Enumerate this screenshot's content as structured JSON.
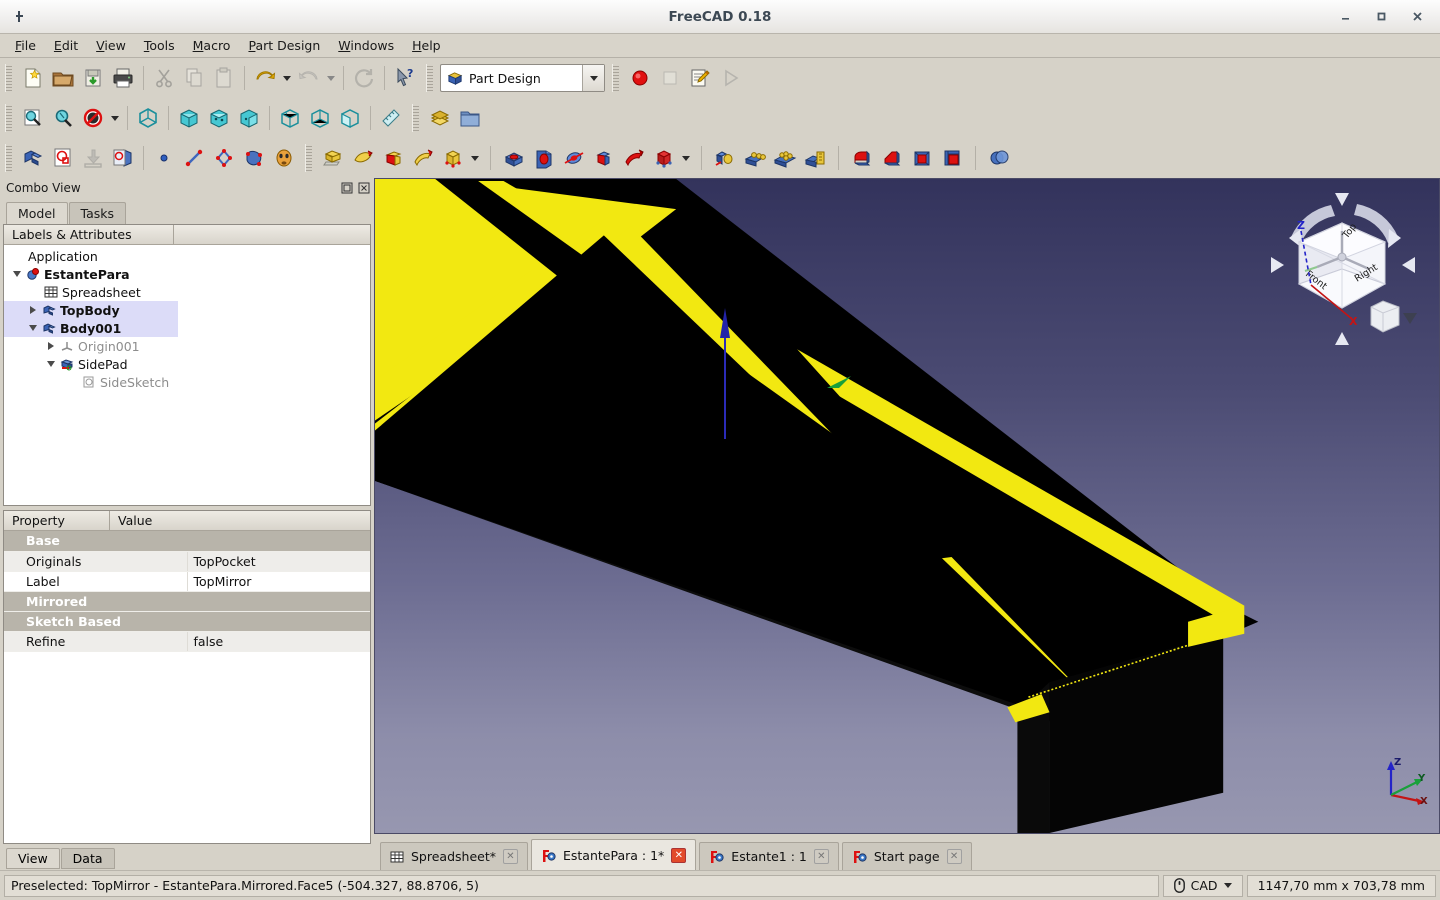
{
  "window": {
    "title": "FreeCAD 0.18",
    "app_icon": "freecad-icon",
    "minimize": "–",
    "maximize": "□",
    "close": "✕"
  },
  "menu": {
    "items": [
      {
        "label": "File",
        "mnemonic": "F"
      },
      {
        "label": "Edit",
        "mnemonic": "E"
      },
      {
        "label": "View",
        "mnemonic": "V"
      },
      {
        "label": "Tools",
        "mnemonic": "T"
      },
      {
        "label": "Macro",
        "mnemonic": "M"
      },
      {
        "label": "Part Design",
        "mnemonic": "P"
      },
      {
        "label": "Windows",
        "mnemonic": "W"
      },
      {
        "label": "Help",
        "mnemonic": "H"
      }
    ]
  },
  "toolbars": {
    "file": [
      {
        "icon": "new-document-icon",
        "label": "New"
      },
      {
        "icon": "open-folder-icon",
        "label": "Open"
      },
      {
        "icon": "save-icon",
        "label": "Save"
      },
      {
        "icon": "print-icon",
        "label": "Print"
      },
      {
        "icon": "cut-scissors-icon",
        "label": "Cut"
      },
      {
        "icon": "copy-icon",
        "label": "Copy"
      },
      {
        "icon": "paste-icon",
        "label": "Paste"
      },
      {
        "icon": "undo-arrow-icon",
        "label": "Undo"
      },
      {
        "icon": "redo-arrow-icon",
        "label": "Redo"
      },
      {
        "icon": "refresh-icon",
        "label": "Refresh"
      },
      {
        "icon": "whats-this-icon",
        "label": "What's This"
      }
    ],
    "workbench": {
      "icon": "part-design-icon",
      "value": "Part Design",
      "arrow": "chevron-down-icon"
    },
    "macro": [
      {
        "icon": "record-macro-icon",
        "label": "Macro recording"
      },
      {
        "icon": "stop-macro-icon",
        "label": "Stop macro recording"
      },
      {
        "icon": "edit-macro-icon",
        "label": "Macros"
      },
      {
        "icon": "execute-macro-icon",
        "label": "Execute macro"
      }
    ],
    "view": [
      {
        "icon": "fit-all-icon",
        "label": "Fit all"
      },
      {
        "icon": "fit-selection-icon",
        "label": "Fit selection"
      },
      {
        "icon": "draw-style-icon",
        "label": "Draw style"
      },
      {
        "icon": "axonometric-icon",
        "label": "Axonometric"
      },
      {
        "icon": "front-view-icon",
        "label": "Front"
      },
      {
        "icon": "top-view-icon",
        "label": "Top"
      },
      {
        "icon": "right-view-icon",
        "label": "Right"
      },
      {
        "icon": "rear-view-icon",
        "label": "Rear"
      },
      {
        "icon": "bottom-view-icon",
        "label": "Bottom"
      },
      {
        "icon": "left-view-icon",
        "label": "Left"
      },
      {
        "icon": "measure-icon",
        "label": "Measure"
      },
      {
        "icon": "layers-icon",
        "label": "Layers"
      },
      {
        "icon": "workbench-folder-icon",
        "label": "Folder"
      }
    ],
    "partdesign_helper": [
      {
        "icon": "create-body-icon",
        "label": "Create body"
      },
      {
        "icon": "create-sketch-icon",
        "label": "Create sketch"
      },
      {
        "icon": "attach-sketch-icon",
        "label": "Attach sketch"
      },
      {
        "icon": "edit-sketch-icon",
        "label": "Edit sketch"
      },
      {
        "icon": "datum-point-icon",
        "label": "Create datum point"
      },
      {
        "icon": "datum-line-icon",
        "label": "Create datum line"
      },
      {
        "icon": "datum-plane-icon",
        "label": "Create datum plane"
      },
      {
        "icon": "shape-binder-icon",
        "label": "Shape binder"
      },
      {
        "icon": "clone-icon",
        "label": "Sub-object shape binder"
      }
    ],
    "additive": [
      {
        "icon": "pad-icon",
        "label": "Pad"
      },
      {
        "icon": "revolution-icon",
        "label": "Revolution"
      },
      {
        "icon": "additive-loft-icon",
        "label": "Additive loft"
      },
      {
        "icon": "additive-pipe-icon",
        "label": "Additive pipe"
      },
      {
        "icon": "additive-box-icon",
        "label": "Additive box"
      }
    ],
    "subtractive": [
      {
        "icon": "pocket-icon",
        "label": "Pocket"
      },
      {
        "icon": "hole-icon",
        "label": "Hole"
      },
      {
        "icon": "groove-icon",
        "label": "Groove"
      },
      {
        "icon": "subtractive-loft-icon",
        "label": "Subtractive loft"
      },
      {
        "icon": "subtractive-pipe-icon",
        "label": "Subtractive pipe"
      },
      {
        "icon": "subtractive-box-icon",
        "label": "Subtractive box"
      }
    ],
    "transform": [
      {
        "icon": "mirrored-icon",
        "label": "Mirrored"
      },
      {
        "icon": "linear-pattern-icon",
        "label": "LinearPattern"
      },
      {
        "icon": "polar-pattern-icon",
        "label": "PolarPattern"
      },
      {
        "icon": "multi-transform-icon",
        "label": "Create MultiTransform"
      }
    ],
    "dressup": [
      {
        "icon": "fillet-icon",
        "label": "Fillet"
      },
      {
        "icon": "chamfer-icon",
        "label": "Chamfer"
      },
      {
        "icon": "draft-icon",
        "label": "Draft"
      },
      {
        "icon": "thickness-icon",
        "label": "Thickness"
      }
    ],
    "boolean": [
      {
        "icon": "boolean-icon",
        "label": "Boolean operation"
      }
    ]
  },
  "combo_view": {
    "title": "Combo View",
    "float_button": "undock-icon",
    "close_button": "close-icon",
    "tabs": [
      {
        "label": "Model",
        "active": true
      },
      {
        "label": "Tasks",
        "active": false
      }
    ],
    "tree_column_header": "Labels & Attributes",
    "tree": [
      {
        "label": "Application",
        "depth": 0,
        "twist": "none",
        "icon": "none",
        "bold": false,
        "dim": false,
        "selected": false
      },
      {
        "label": "EstantePara",
        "depth": 1,
        "twist": "open",
        "icon": "document-icon",
        "bold": true,
        "dim": false,
        "selected": false
      },
      {
        "label": "Spreadsheet",
        "depth": 2,
        "twist": "none",
        "icon": "spreadsheet-icon",
        "bold": false,
        "dim": false,
        "selected": false
      },
      {
        "label": "TopBody",
        "depth": 2,
        "twist": "closed",
        "icon": "body-icon",
        "bold": true,
        "dim": false,
        "selected": true
      },
      {
        "label": "Body001",
        "depth": 2,
        "twist": "open",
        "icon": "body-icon",
        "bold": true,
        "dim": false,
        "selected": true
      },
      {
        "label": "Origin001",
        "depth": 3,
        "twist": "closed",
        "icon": "origin-icon",
        "bold": false,
        "dim": true,
        "selected": false
      },
      {
        "label": "SidePad",
        "depth": 3,
        "twist": "open",
        "icon": "pad-feature-icon",
        "bold": false,
        "dim": false,
        "selected": false
      },
      {
        "label": "SideSketch",
        "depth": 4,
        "twist": "none",
        "icon": "sketch-icon",
        "bold": false,
        "dim": true,
        "selected": false
      }
    ],
    "property_headers": [
      "Property",
      "Value"
    ],
    "properties": [
      {
        "type": "group",
        "name": "Base",
        "value": ""
      },
      {
        "type": "row",
        "name": "Originals",
        "value": "TopPocket"
      },
      {
        "type": "row",
        "name": "Label",
        "value": "TopMirror"
      },
      {
        "type": "group",
        "name": "Mirrored",
        "value": ""
      },
      {
        "type": "group",
        "name": "Sketch Based",
        "value": ""
      },
      {
        "type": "row",
        "name": "Refine",
        "value": "false"
      }
    ],
    "bottom_tabs": [
      {
        "label": "View",
        "active": true
      },
      {
        "label": "Data",
        "active": false
      }
    ]
  },
  "viewport": {
    "navcube": {
      "faces": {
        "top": "Top",
        "front": "Front",
        "right": "Right"
      },
      "axis_z": "Z",
      "axis_x": "X",
      "corner_cube": "home-view-cube-icon",
      "corner_arrow": "chevron-down-icon"
    },
    "axis_cross": {
      "x": "X",
      "y": "Y",
      "z": "Z"
    },
    "colors": {
      "background_top": "#33335c",
      "background_bottom": "#9797b0",
      "shape": "#000000",
      "preselect_highlight": "#ffff00"
    }
  },
  "document_tabs": [
    {
      "label": "Spreadsheet*",
      "icon": "spreadsheet-icon",
      "active": false,
      "close": "✕"
    },
    {
      "label": "EstantePara : 1*",
      "icon": "freecad-doc-icon",
      "active": true,
      "close": "✕"
    },
    {
      "label": "Estante1 : 1",
      "icon": "freecad-doc-icon",
      "active": false,
      "close": "✕"
    },
    {
      "label": "Start page",
      "icon": "freecad-doc-icon",
      "active": false,
      "close": "✕"
    }
  ],
  "statusbar": {
    "message": "Preselected: TopMirror - EstantePara.Mirrored.Face5 (-504.327, 88.8706, 5)",
    "navigation_icon": "mouse-icon",
    "navigation_label": "CAD",
    "navigation_arrow": "chevron-down-icon",
    "dimensions": "1147,70 mm x 703,78 mm"
  }
}
